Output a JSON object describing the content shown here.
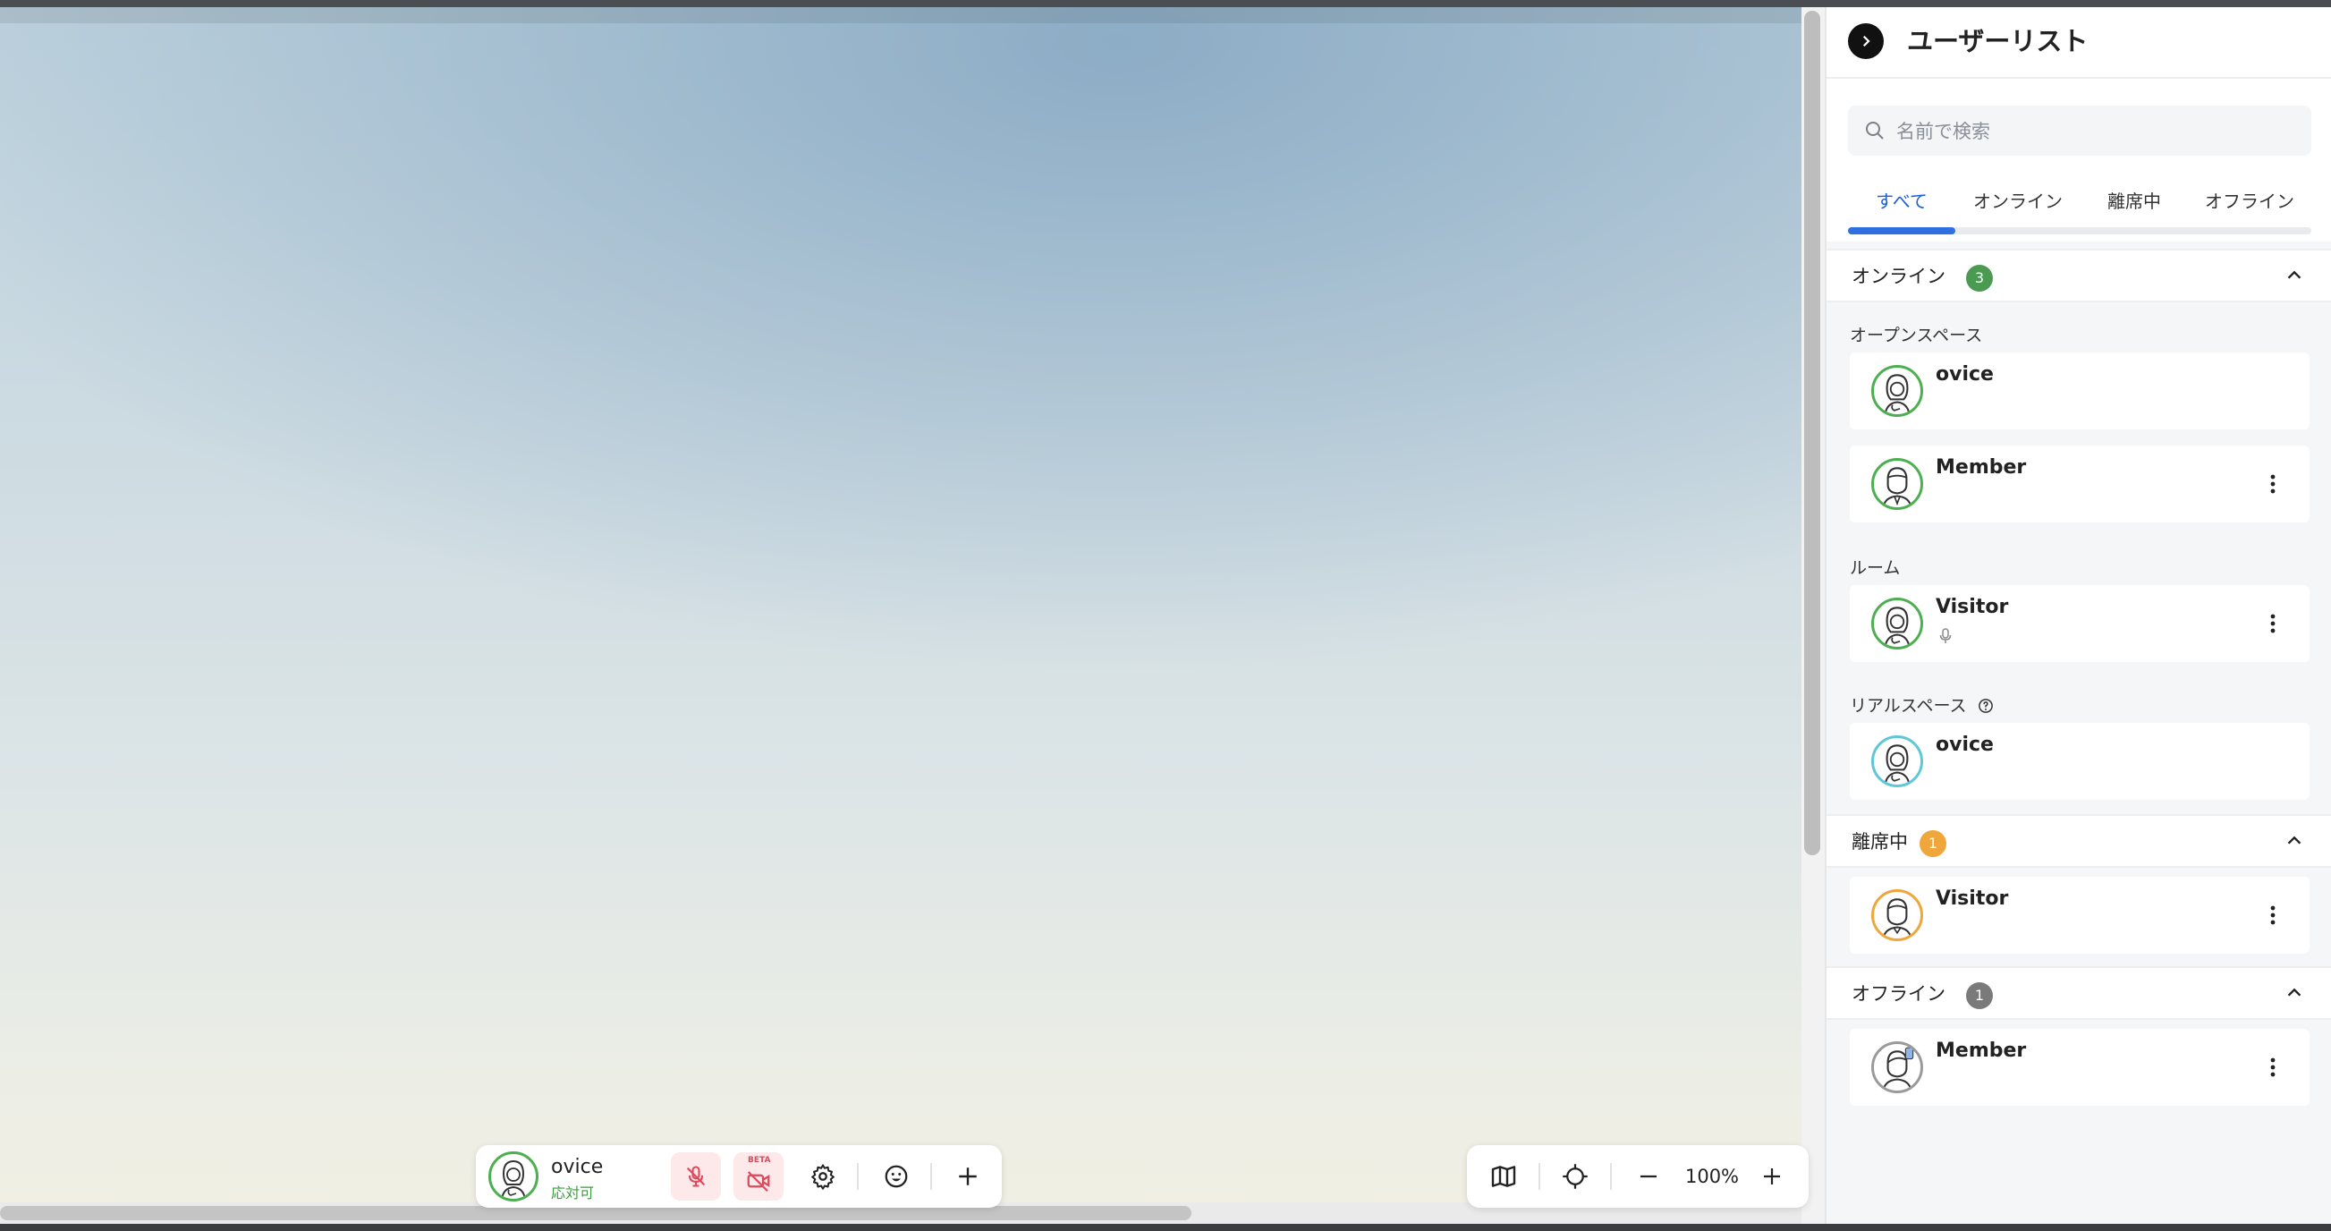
{
  "panel": {
    "title": "ユーザーリスト",
    "search_placeholder": "名前で検索",
    "tabs": [
      {
        "label": "すべて",
        "active": true
      },
      {
        "label": "オンライン",
        "active": false
      },
      {
        "label": "離席中",
        "active": false
      },
      {
        "label": "オフライン",
        "active": false
      }
    ],
    "groups": {
      "online": {
        "title": "オンライン",
        "count": "3",
        "badge_color": "#4a9a52",
        "sections": {
          "open_space": {
            "label": "オープンスペース",
            "users": [
              {
                "name": "ovice"
              },
              {
                "name": "Member"
              }
            ]
          },
          "room": {
            "label": "ルーム",
            "users": [
              {
                "name": "Visitor"
              }
            ]
          },
          "real_space": {
            "label": "リアルスペース",
            "users": [
              {
                "name": "ovice"
              }
            ]
          }
        }
      },
      "away": {
        "title": "離席中",
        "count": "1",
        "badge_color": "#efa63a",
        "users": [
          {
            "name": "Visitor"
          }
        ]
      },
      "offline": {
        "title": "オフライン",
        "count": "1",
        "badge_color": "#7a7a7a",
        "users": [
          {
            "name": "Member"
          }
        ]
      }
    }
  },
  "user_toolbar": {
    "name": "ovice",
    "status": "応対可",
    "beta_label": "BETA"
  },
  "zoom_toolbar": {
    "zoom_level": "100%"
  },
  "colors": {
    "accent": "#2f6fdf",
    "online": "#4caf50",
    "away": "#efa63a",
    "offline": "#7a7a7a",
    "mute": "#d94a5c"
  }
}
